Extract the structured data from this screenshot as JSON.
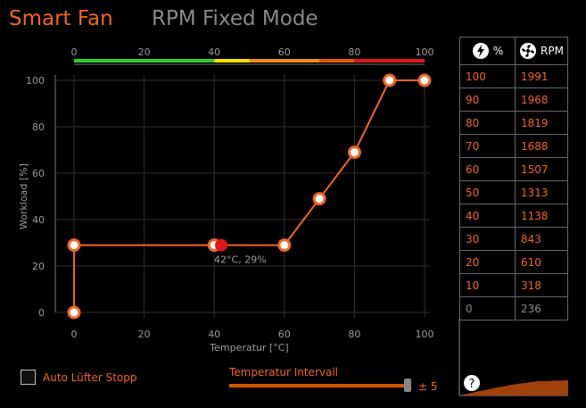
{
  "tabs": {
    "active": "Smart Fan",
    "inactive": "RPM Fixed Mode"
  },
  "chart_data": {
    "type": "line",
    "xlabel": "Temperatur [°C]",
    "ylabel": "Workload [%]",
    "xlim": [
      0,
      100
    ],
    "ylim": [
      0,
      100
    ],
    "x_ticks": [
      "0",
      "20",
      "40",
      "60",
      "80",
      "100"
    ],
    "y_ticks": [
      "0",
      "20",
      "40",
      "60",
      "80",
      "100"
    ],
    "top_scale_ticks": [
      "0",
      "20",
      "40",
      "60",
      "80",
      "100"
    ],
    "grid": true,
    "points": [
      [
        0,
        0
      ],
      [
        0,
        29
      ],
      [
        40,
        29
      ],
      [
        60,
        29
      ],
      [
        70,
        49
      ],
      [
        80,
        69
      ],
      [
        90,
        100
      ],
      [
        100,
        100
      ]
    ],
    "current_point": [
      42,
      29
    ],
    "current_label": "42°C, 29%",
    "color_bar": [
      {
        "from": 0,
        "to": 40,
        "color": "#2ecc2e"
      },
      {
        "from": 40,
        "to": 50,
        "color": "#f5e000"
      },
      {
        "from": 50,
        "to": 70,
        "color": "#f28c1e"
      },
      {
        "from": 70,
        "to": 80,
        "color": "#e05a10"
      },
      {
        "from": 80,
        "to": 100,
        "color": "#e01818"
      }
    ]
  },
  "rpm_table": {
    "headers": [
      "%",
      "RPM"
    ],
    "rows": [
      [
        "100",
        "1991"
      ],
      [
        "90",
        "1968"
      ],
      [
        "80",
        "1819"
      ],
      [
        "70",
        "1688"
      ],
      [
        "60",
        "1507"
      ],
      [
        "50",
        "1313"
      ],
      [
        "40",
        "1138"
      ],
      [
        "30",
        "843"
      ],
      [
        "20",
        "610"
      ],
      [
        "10",
        "318"
      ],
      [
        "0",
        "236"
      ]
    ]
  },
  "controls": {
    "auto_stop_label": "Auto Lüfter Stopp",
    "interval_label": "Temperatur Intervall",
    "interval_value": "± 5",
    "help_symbol": "?"
  },
  "colors": {
    "accent": "#f26522",
    "inactive": "#8a8a8a"
  }
}
